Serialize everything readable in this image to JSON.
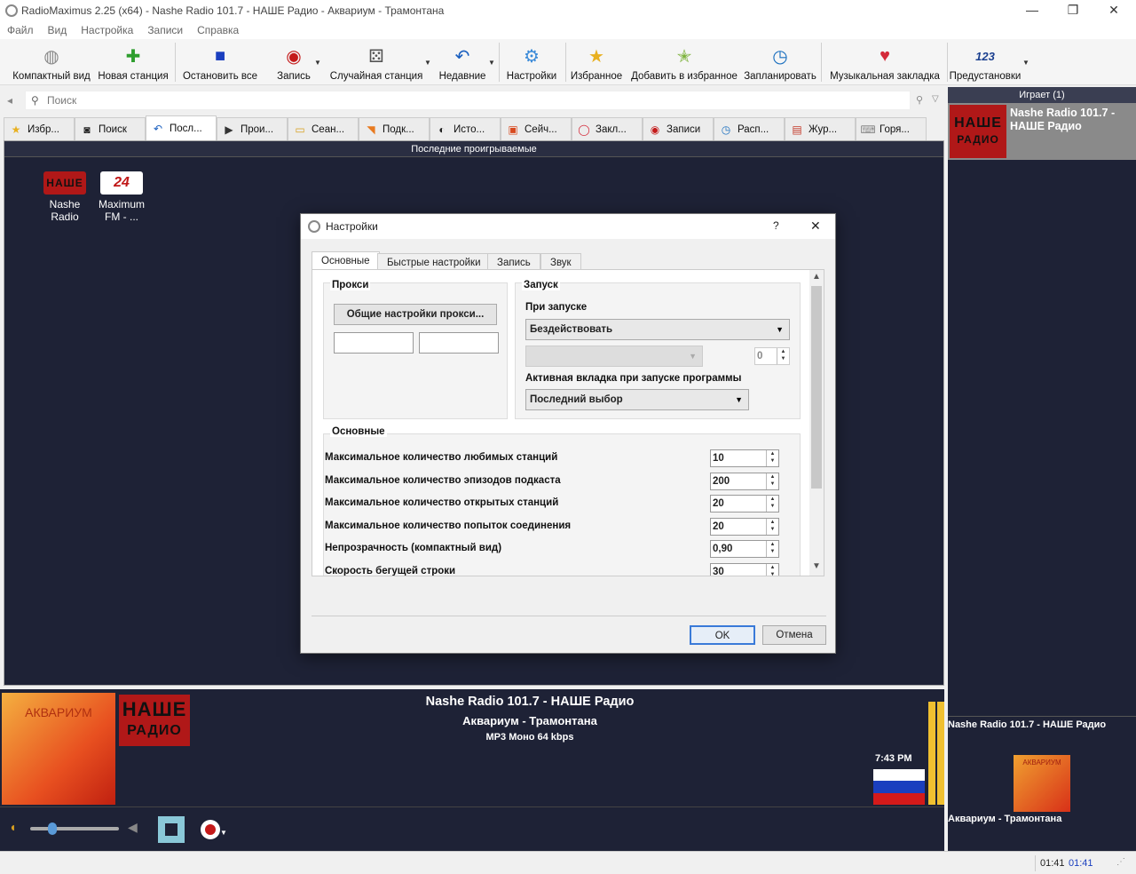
{
  "window": {
    "title": "RadioMaximus 2.25 (x64) - Nashe Radio 101.7 - НАШЕ Радио - Аквариум - Трамонтана",
    "minimize": "—",
    "restore": "❐",
    "close": "✕"
  },
  "menu": [
    "Файл",
    "Вид",
    "Настройка",
    "Записи",
    "Справка"
  ],
  "toolbar": [
    {
      "label": "Компактный вид",
      "icon": "compact-view-icon",
      "glyph": "◍",
      "color": "#888"
    },
    {
      "label": "Новая станция",
      "icon": "plus-icon",
      "glyph": "✚",
      "color": "#2e9e2e"
    },
    {
      "label": "Остановить все",
      "icon": "stop-all-icon",
      "glyph": "■",
      "color": "#1a3fbf"
    },
    {
      "label": "Запись",
      "icon": "record-icon",
      "glyph": "◉",
      "color": "#c41a1a"
    },
    {
      "label": "Случайная станция",
      "icon": "dice-icon",
      "glyph": "⚄",
      "color": "#555"
    },
    {
      "label": "Недавние",
      "icon": "undo-arrow-icon",
      "glyph": "↶",
      "color": "#1a5fbf"
    },
    {
      "label": "Настройки",
      "icon": "gear-icon",
      "glyph": "⚙",
      "color": "#3a8ad8"
    },
    {
      "label": "Избранное",
      "icon": "star-icon",
      "glyph": "★",
      "color": "#e8b020"
    },
    {
      "label": "Добавить в избранное",
      "icon": "star-plus-icon",
      "glyph": "✭",
      "color": "#7cb23a"
    },
    {
      "label": "Запланировать",
      "icon": "clock-icon",
      "glyph": "◷",
      "color": "#1a6fbf"
    },
    {
      "label": "Музыкальная закладка",
      "icon": "heart-plus-icon",
      "glyph": "♥",
      "color": "#d42a3a"
    },
    {
      "label": "Предустановки",
      "icon": "presets-123-icon",
      "glyph": "123",
      "color": "#1a3f8f"
    }
  ],
  "search": {
    "placeholder": "Поиск"
  },
  "tabs": [
    {
      "label": "Избр...",
      "icon": "star-icon",
      "glyph": "★",
      "color": "#e8b020"
    },
    {
      "label": "Поиск",
      "icon": "search-icon",
      "glyph": "◙",
      "color": "#222"
    },
    {
      "label": "Посл...",
      "icon": "recent-icon",
      "glyph": "↶",
      "color": "#1a5fbf"
    },
    {
      "label": "Прои...",
      "icon": "play-icon",
      "glyph": "▶",
      "color": "#333"
    },
    {
      "label": "Сеан...",
      "icon": "folder-icon",
      "glyph": "▭",
      "color": "#d8a020"
    },
    {
      "label": "Подк...",
      "icon": "rss-icon",
      "glyph": "◥",
      "color": "#e87a20"
    },
    {
      "label": "Исто...",
      "icon": "history-icon",
      "glyph": "◐",
      "color": "#222"
    },
    {
      "label": "Сейч...",
      "icon": "now-icon",
      "glyph": "▣",
      "color": "#d84a20"
    },
    {
      "label": "Закл...",
      "icon": "bookmark-icon",
      "glyph": "◯",
      "color": "#d42a3a"
    },
    {
      "label": "Записи",
      "icon": "record-icon",
      "glyph": "◉",
      "color": "#c41a1a"
    },
    {
      "label": "Расп...",
      "icon": "schedule-icon",
      "glyph": "◷",
      "color": "#1a6fbf"
    },
    {
      "label": "Жур...",
      "icon": "log-icon",
      "glyph": "▤",
      "color": "#c43a2a"
    },
    {
      "label": "Горя...",
      "icon": "keyboard-icon",
      "glyph": "⌨",
      "color": "#888"
    }
  ],
  "main": {
    "header": "Последние проигрываемые",
    "stations": [
      {
        "name": "Nashe Radio",
        "logo_text": "НАШЕ"
      },
      {
        "name": "Maximum FM - ...",
        "logo_text": "24"
      }
    ]
  },
  "right_panel": {
    "header": "Играет (1)",
    "item_title": "Nashe Radio 101.7 - НАШЕ Радио",
    "logo_text": "НАШЕ",
    "logo_sub": "РАДИО",
    "bottom_station": "Nashe Radio 101.7 - НАШЕ Радио",
    "bottom_track": "Аквариум - Трамонтана",
    "album_text": "АКВАРИУМ"
  },
  "now_playing": {
    "station": "Nashe Radio 101.7 - НАШЕ Радио",
    "track": "Аквариум - Трамонтана",
    "format": "MP3 Моно 64 kbps",
    "time": "7:43 PM",
    "album_text": "АКВАРИУМ",
    "logo_text": "НАШЕ",
    "logo_sub": "РАДИО",
    "volume": 0.25
  },
  "status": {
    "elapsed": "01:41",
    "total": "01:41"
  },
  "dialog": {
    "title": "Настройки",
    "help": "?",
    "close": "✕",
    "tabs": [
      "Основные",
      "Быстрые настройки",
      "Запись",
      "Звук"
    ],
    "proxy": {
      "title": "Прокси",
      "button": "Общие настройки прокси..."
    },
    "startup": {
      "title": "Запуск",
      "on_start_label": "При запуске",
      "on_start_value": "Бездействовать",
      "spin_value": "0",
      "active_tab_label": "Активная вкладка при запуске программы",
      "active_tab_value": "Последний выбор"
    },
    "general": {
      "title": "Основные",
      "rows": [
        {
          "label": "Максимальное количество любимых станций",
          "value": "10"
        },
        {
          "label": "Максимальное количество эпизодов подкаста",
          "value": "200"
        },
        {
          "label": "Максимальное количество открытых станций",
          "value": "20"
        },
        {
          "label": "Максимальное количество попыток соединения",
          "value": "20"
        },
        {
          "label": "Непрозрачность (компактный вид)",
          "value": "0,90"
        },
        {
          "label": "Скорость бегущей строки",
          "value": "30"
        }
      ]
    },
    "ok": "OK",
    "cancel": "Отмена"
  }
}
